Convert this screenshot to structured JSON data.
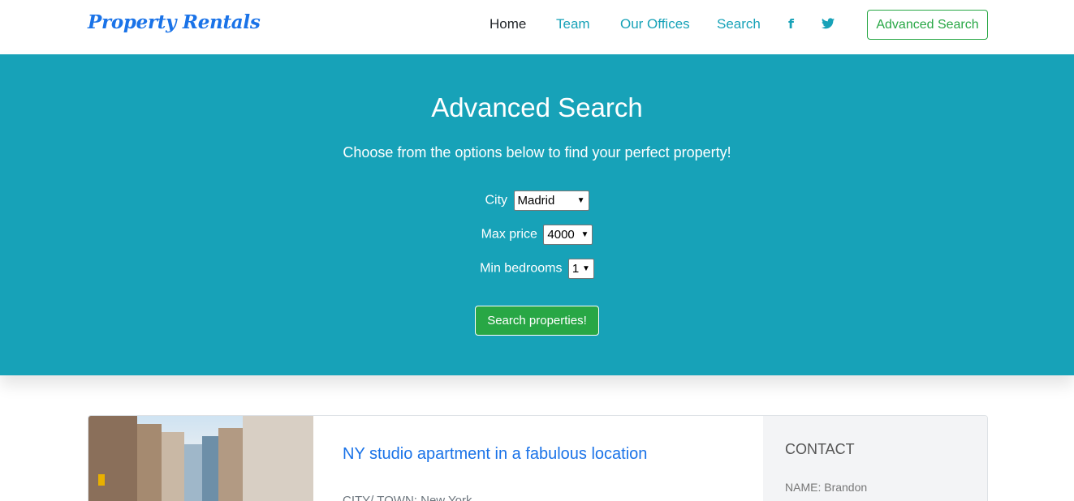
{
  "nav": {
    "brand": "Property Rentals",
    "links": [
      "Home",
      "Team",
      "Our Offices",
      "Search"
    ],
    "social_icons": [
      "facebook-icon",
      "twitter-icon"
    ],
    "cta": "Advanced Search",
    "colors": {
      "link": "#17a2b8",
      "active": "#212529",
      "brand": "#1a73e8",
      "cta": "#28a745"
    }
  },
  "hero": {
    "title": "Advanced Search",
    "subtitle": "Choose from the options below to find your perfect property!",
    "fields": [
      {
        "label": "City",
        "value": "Madrid"
      },
      {
        "label": "Max price",
        "value": "4000"
      },
      {
        "label": "Min bedrooms",
        "value": "1"
      }
    ],
    "button": "Search properties!",
    "background": "#17a2b8"
  },
  "listing": {
    "title": "NY studio apartment in a fabulous location",
    "meta": "CITY/ TOWN: New York",
    "contact": {
      "heading": "CONTACT",
      "name": "NAME: Brandon"
    }
  }
}
